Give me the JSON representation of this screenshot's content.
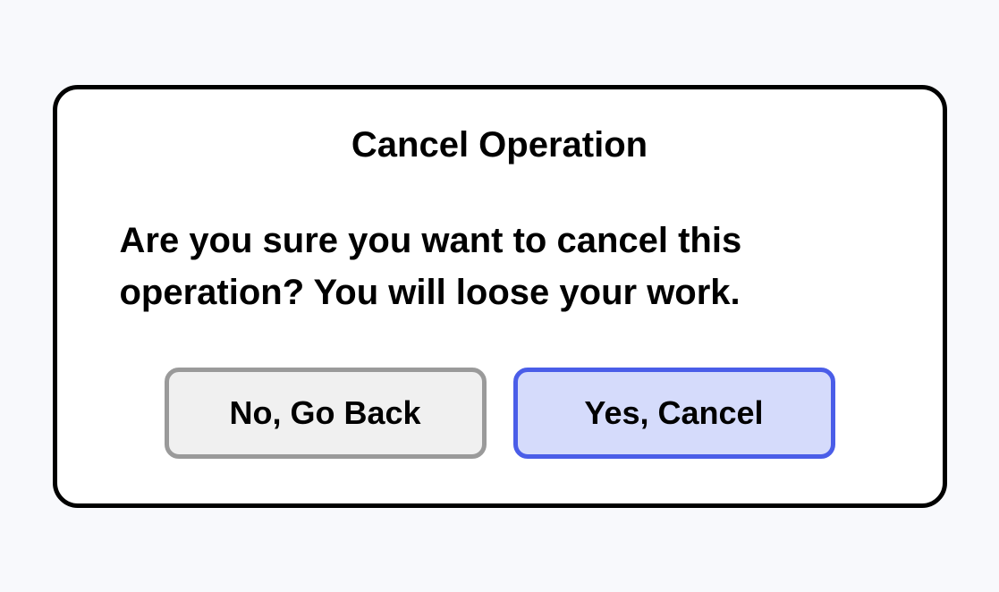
{
  "dialog": {
    "title": "Cancel Operation",
    "message": "Are you sure you want to cancel this operation? You will loose your work.",
    "actions": {
      "secondary_label": "No, Go Back",
      "primary_label": "Yes, Cancel"
    }
  },
  "colors": {
    "background": "#f8f9fc",
    "dialog_bg": "#ffffff",
    "dialog_border": "#000000",
    "text": "#000000",
    "secondary_btn_bg": "#f0f0f0",
    "secondary_btn_border": "#9a9a9a",
    "primary_btn_bg": "#d5dbfb",
    "primary_btn_border": "#4a5de8"
  }
}
